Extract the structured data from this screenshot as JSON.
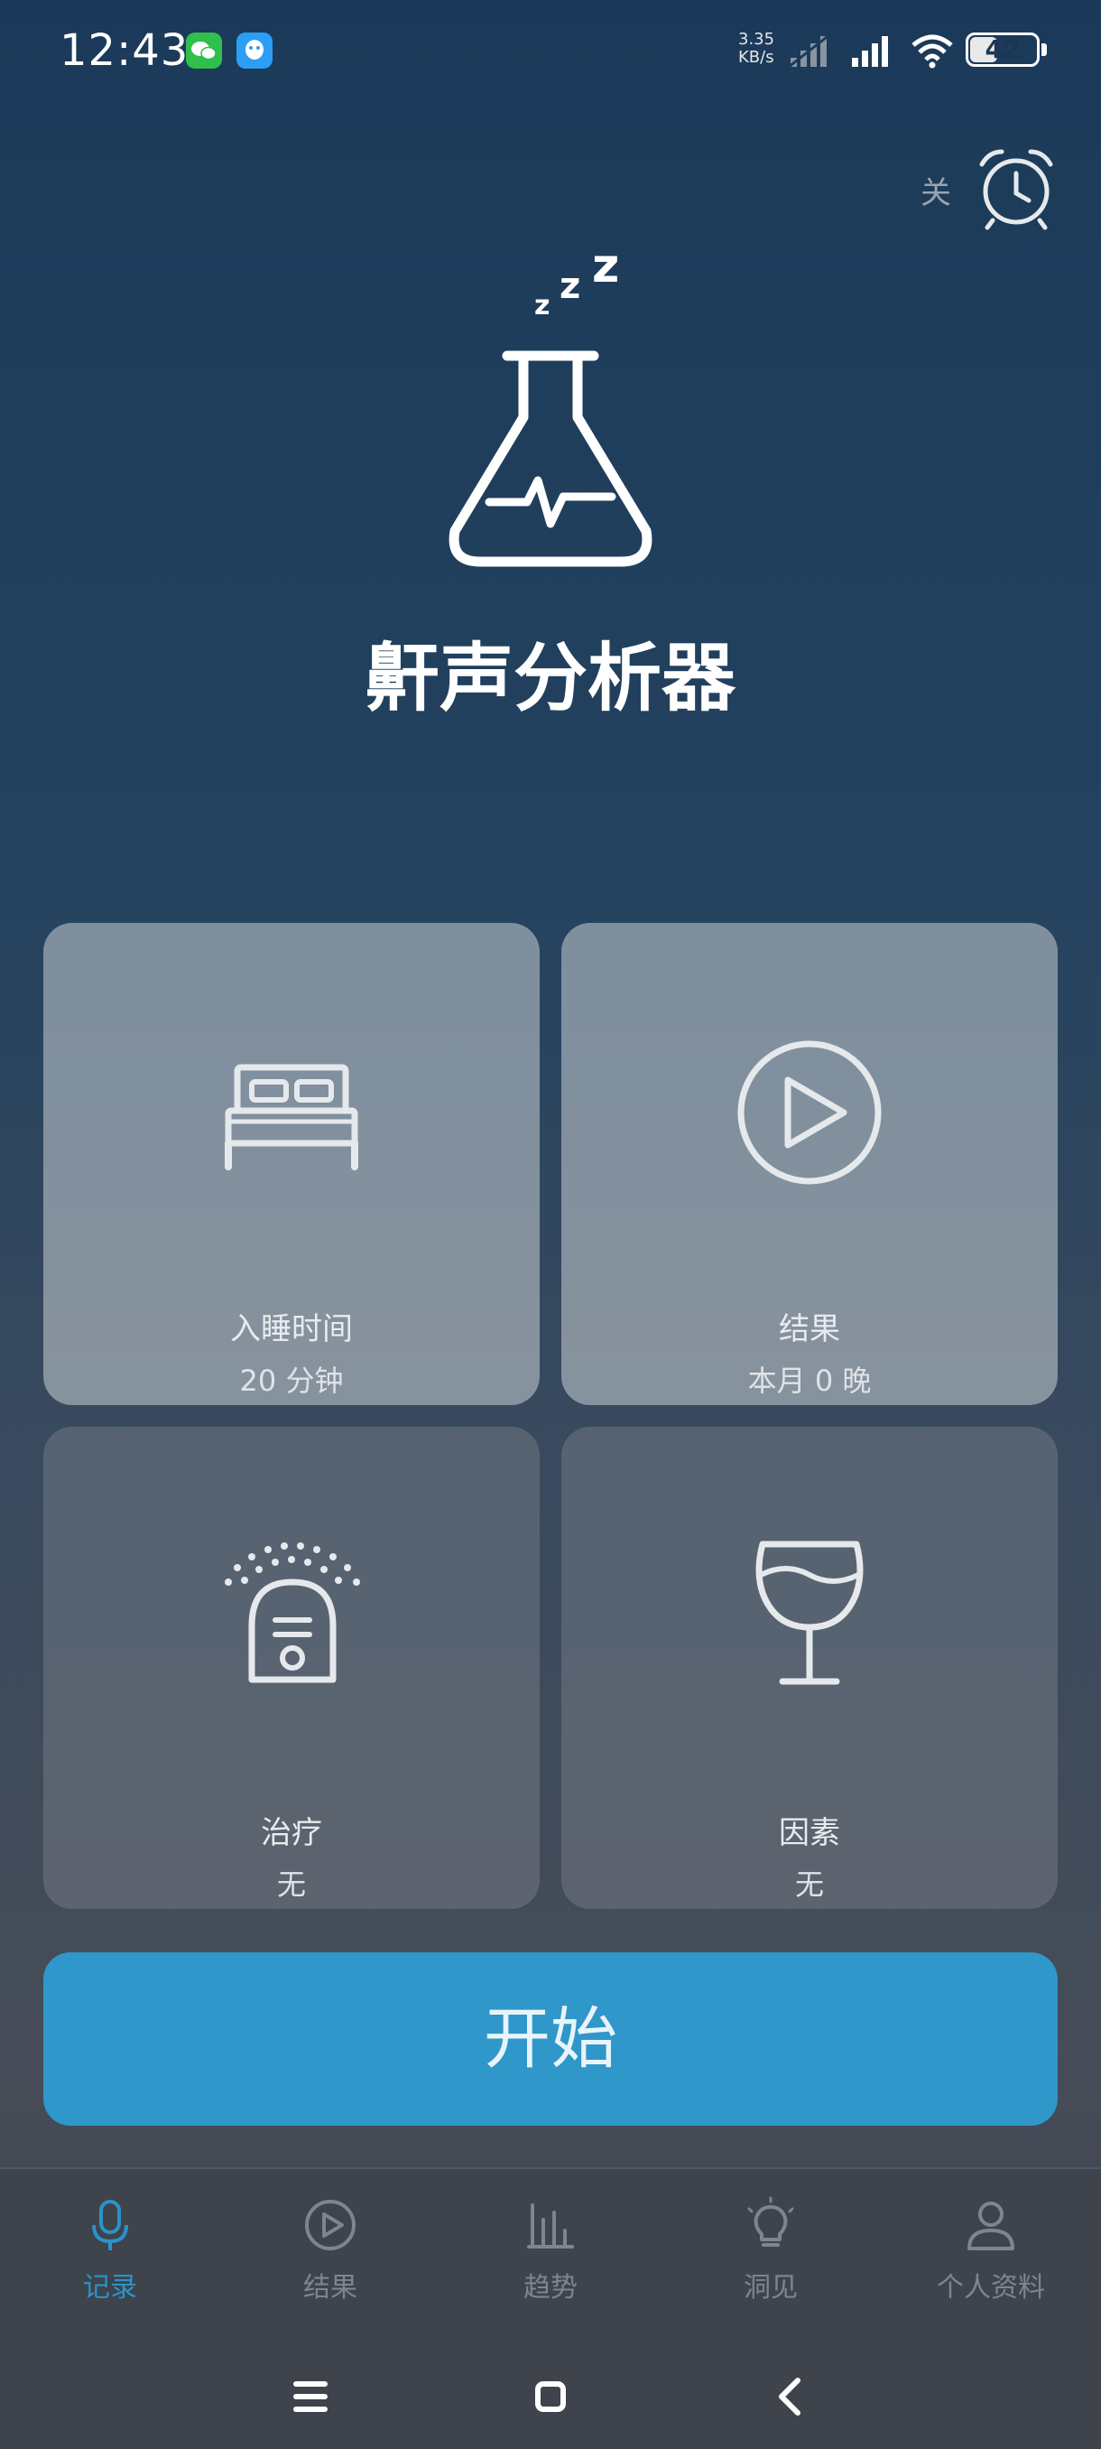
{
  "status_bar": {
    "time": "12:43",
    "net_speed_value": "3.35",
    "net_speed_unit": "KB/s",
    "battery": "42",
    "battery_level": 0.42
  },
  "alarm": {
    "label": "关"
  },
  "app": {
    "title": "鼾声分析器"
  },
  "cards": [
    {
      "label": "入睡时间",
      "value": "20 分钟",
      "icon": "bed-icon"
    },
    {
      "label": "结果",
      "value": "本月 0 晚",
      "icon": "play-circle-icon"
    },
    {
      "label": "治疗",
      "value": "无",
      "icon": "humidifier-icon"
    },
    {
      "label": "因素",
      "value": "无",
      "icon": "wine-glass-icon"
    }
  ],
  "start_button": {
    "label": "开始"
  },
  "bottom_nav": {
    "items": [
      {
        "label": "记录",
        "icon": "microphone-icon",
        "active": true
      },
      {
        "label": "结果",
        "icon": "play-circle-icon",
        "active": false
      },
      {
        "label": "趋势",
        "icon": "bar-chart-icon",
        "active": false
      },
      {
        "label": "洞见",
        "icon": "lightbulb-icon",
        "active": false
      },
      {
        "label": "个人资料",
        "icon": "person-icon",
        "active": false
      }
    ]
  },
  "colors": {
    "accent": "#2f97c9",
    "active_nav": "#2b93c8",
    "inactive_nav": "#7f8590"
  }
}
